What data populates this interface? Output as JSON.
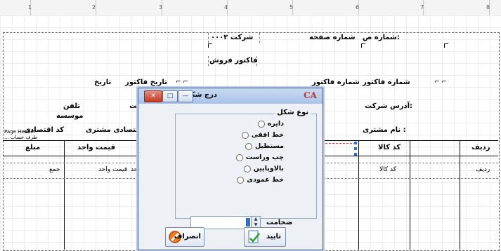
{
  "ruler": {
    "numbers": [
      "1",
      "2",
      "3",
      "4",
      "5",
      "6",
      "7",
      "8"
    ]
  },
  "report": {
    "company": "شرکت ۰۰۰۲",
    "page_number_label": "شماره صفحه",
    "page_number_value": ":شماره ص",
    "invoice_title": "فاکتور فروش",
    "invoice_date_label": "تاریخ فاکتور",
    "invoice_date_value": "تاریخ",
    "invoice_number_label": "شماره فاکتور",
    "invoice_number_value": "شماره فاکتور",
    "phone_label": "تلفن",
    "institution_label": "موسسه",
    "company_label": "شرکت",
    "company_address_label": ":آدرس شرکت",
    "economic_code_label": "کد اقتصادی",
    "customer_economic_code_label": "اقتصادی مشتری",
    "customer_name_label": ": نام مشتری",
    "page_header_tag": "Page Header",
    "account_id_fragment": "طرف حساب ...",
    "headers": {
      "row": "ردیف",
      "code": "کد کالا",
      "unit_price": "قیمت واحد",
      "amount": "مبلغ"
    },
    "row_values": {
      "row": "ردیف",
      "code": "کد کالا",
      "unit_price": "قیمت واحد",
      "unit_fragment": "حد",
      "total": "جمع"
    }
  },
  "dialog": {
    "title": "درج شکل هندسی",
    "logo": "CA",
    "minimize": "—",
    "maximize": "□",
    "close": "✕",
    "group_label": "نوع شکل",
    "options": [
      "دایره",
      "خط افقی",
      "مستطیل",
      "چپ وراست",
      "بالاوپایین",
      "خط عمودی"
    ],
    "thickness_label": "ضخامت",
    "thickness_value": "",
    "confirm_label": "تایید",
    "cancel_label": "انصراف"
  },
  "colors": {
    "dialog_title": "#a9c3e8",
    "close_button": "#c23b22",
    "selection_blue": "#2f6fd6"
  }
}
